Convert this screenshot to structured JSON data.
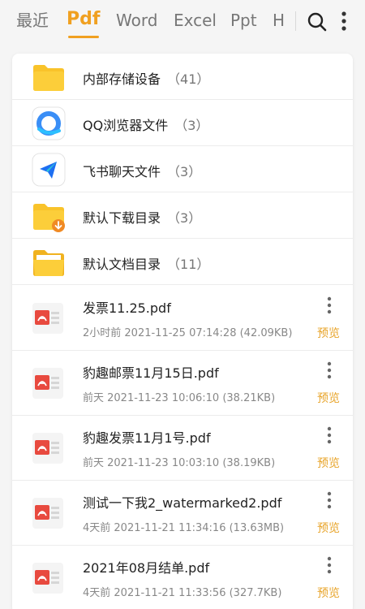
{
  "tabs": [
    {
      "label": "最近"
    },
    {
      "label": "Pdf"
    },
    {
      "label": "Word"
    },
    {
      "label": "Excel"
    },
    {
      "label": "Ppt"
    },
    {
      "label": "H"
    }
  ],
  "active_tab": "Pdf",
  "colors": {
    "accent": "#f0a020",
    "preview": "#e8a42a",
    "pdf_red": "#e84a3f",
    "folder_yellow": "#f9c32a"
  },
  "header": {
    "search_icon": "search-icon",
    "more_icon": "more-vertical-icon"
  },
  "folders": [
    {
      "name": "内部存储设备",
      "count": "（41）",
      "icon": "folder-icon"
    },
    {
      "name": "QQ浏览器文件",
      "count": "（3）",
      "icon": "qq-browser-icon"
    },
    {
      "name": "飞书聊天文件",
      "count": "（3）",
      "icon": "feishu-icon"
    },
    {
      "name": "默认下载目录",
      "count": "（3）",
      "icon": "download-folder-icon"
    },
    {
      "name": "默认文档目录",
      "count": "（11）",
      "icon": "open-folder-icon"
    }
  ],
  "files": [
    {
      "name": "发票11.25.pdf",
      "meta": "2小时前  2021-11-25 07:14:28 (42.09KB)",
      "action": "预览"
    },
    {
      "name": "豹趣邮票11月15日.pdf",
      "meta": "前天  2021-11-23 10:06:10 (38.21KB)",
      "action": "预览"
    },
    {
      "name": "豹趣发票11月1号.pdf",
      "meta": "前天  2021-11-23 10:03:10 (38.19KB)",
      "action": "预览"
    },
    {
      "name": "测试一下我2_watermarked2.pdf",
      "meta": "4天前  2021-11-21 11:34:16 (13.63MB)",
      "action": "预览"
    },
    {
      "name": "2021年08月结单.pdf",
      "meta": "4天前  2021-11-21 11:33:56 (327.7KB)",
      "action": "预览"
    }
  ]
}
